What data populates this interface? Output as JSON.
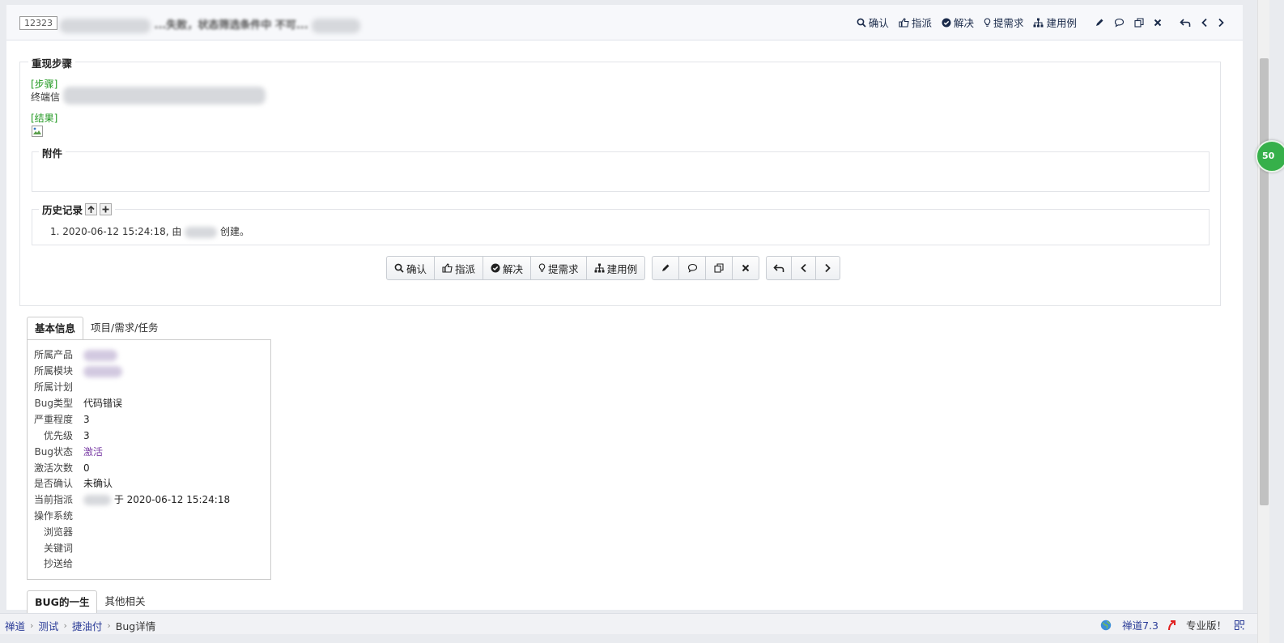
{
  "header": {
    "bug_id": "12323",
    "title_visible": "...失败，状态筛选条件中 不可..."
  },
  "actions": {
    "confirm": "确认",
    "assign": "指派",
    "resolve": "解决",
    "to_story": "提需求",
    "create_case": "建用例"
  },
  "steps": {
    "legend": "重现步骤",
    "step_label": "[步骤]",
    "step_text": "终端信",
    "result_label": "[结果]"
  },
  "attachments": {
    "legend": "附件"
  },
  "history": {
    "legend": "历史记录",
    "entry_prefix": "1. 2020-06-12 15:24:18, 由",
    "entry_suffix": "创建。"
  },
  "info_tabs": {
    "basic": "基本信息",
    "project": "项目/需求/任务"
  },
  "info": {
    "product_label": "所属产品",
    "module_label": "所属模块",
    "plan_label": "所属计划",
    "type_label": "Bug类型",
    "type_value": "代码错误",
    "severity_label": "严重程度",
    "severity_value": "3",
    "priority_label": "优先级",
    "priority_value": "3",
    "status_label": "Bug状态",
    "status_value": "激活",
    "activated_label": "激活次数",
    "activated_value": "0",
    "confirmed_label": "是否确认",
    "confirmed_value": "未确认",
    "assigned_label": "当前指派",
    "assigned_value": "于 2020-06-12 15:24:18",
    "os_label": "操作系统",
    "browser_label": "浏览器",
    "keywords_label": "关键词",
    "cc_label": "抄送给"
  },
  "life_tabs": {
    "life": "BUG的一生",
    "other": "其他相关"
  },
  "footer": {
    "crumb_1": "禅道",
    "crumb_2": "测试",
    "crumb_3": "捷油付",
    "crumb_4": "Bug详情",
    "version": "禅道7.3",
    "pro": "专业版！"
  },
  "float_badge": "50",
  "colors": {
    "link": "#2c3d98",
    "green_label": "#229922",
    "status_purple": "#7b3fa6",
    "badge_green": "#36b04a"
  }
}
